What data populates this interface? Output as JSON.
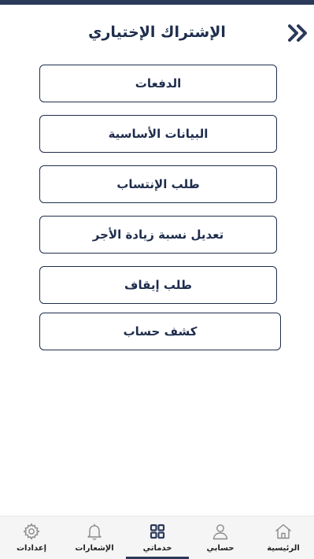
{
  "header": {
    "title": "الإشتراك الإختياري",
    "back_icon": "double-chevron-right-icon"
  },
  "menu": {
    "items": [
      {
        "label": "الدفعات"
      },
      {
        "label": "البيانات الأساسية"
      },
      {
        "label": "طلب الإنتساب"
      },
      {
        "label": "تعديل نسبة زيادة الأجر"
      },
      {
        "label": "طلب إيقاف"
      },
      {
        "label": "كشف  حساب"
      }
    ]
  },
  "bottom_nav": {
    "active": "خدماتي",
    "items": [
      {
        "label": "إعدادات",
        "icon": "gear-icon"
      },
      {
        "label": "الإشعارات",
        "icon": "bell-icon"
      },
      {
        "label": "خدماتي",
        "icon": "grid-icon"
      },
      {
        "label": "حسابي",
        "icon": "user-icon"
      },
      {
        "label": "الرئيسية",
        "icon": "home-icon"
      }
    ]
  },
  "colors": {
    "primary": "#1f2d4d",
    "nav_active": "#2b3a5a",
    "nav_background": "#f5f5f5"
  }
}
